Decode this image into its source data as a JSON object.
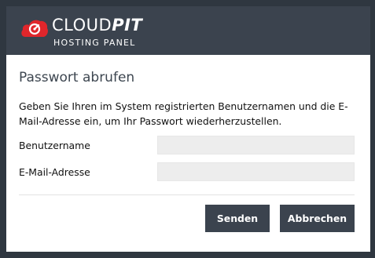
{
  "brand": {
    "name_light": "CLOUD",
    "name_bold": "PIT",
    "subtitle": "HOSTING PANEL",
    "accent_color": "#e0262b",
    "logo_icon": "cloud-logo-icon"
  },
  "dialog": {
    "title": "Passwort abrufen",
    "description": "Geben Sie Ihren im System registrierten Benutzernamen und die E-Mail-Adresse ein, um Ihr Passwort wiederherzustellen.",
    "fields": {
      "username": {
        "label": "Benutzername",
        "value": ""
      },
      "email": {
        "label": "E-Mail-Adresse",
        "value": ""
      }
    },
    "buttons": {
      "send": "Senden",
      "cancel": "Abbrechen"
    }
  },
  "colors": {
    "header_bg": "#3b434e",
    "backdrop": "#2f3740",
    "button_bg": "#3b434e",
    "input_bg": "#ededed"
  }
}
